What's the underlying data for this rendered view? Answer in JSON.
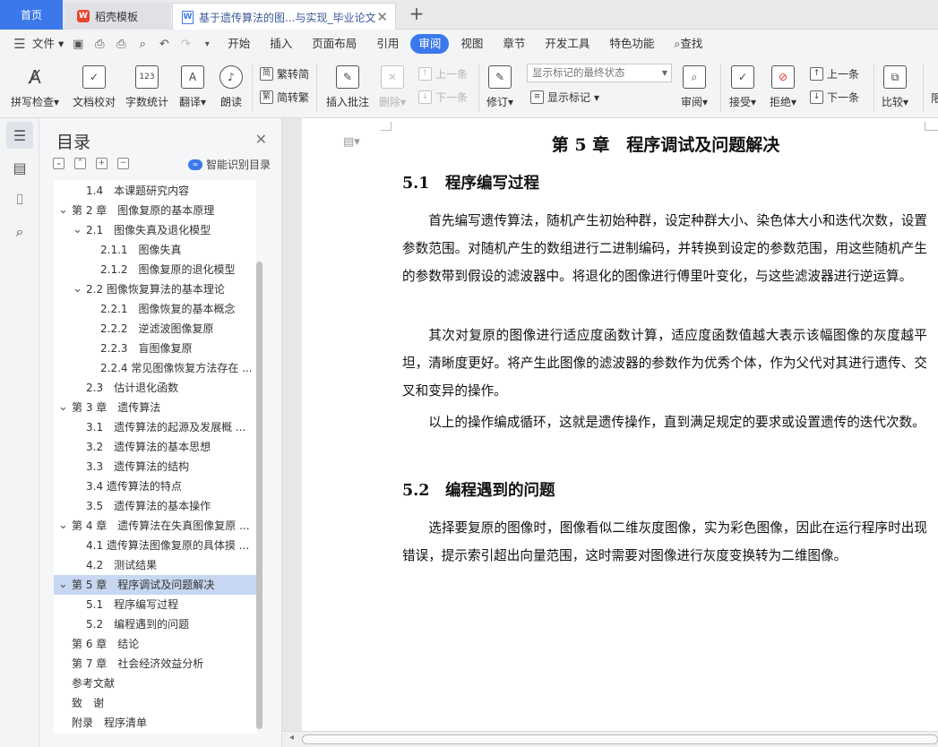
{
  "tabs": {
    "home": "首页",
    "template": "稻壳模板",
    "document": "基于遗传算法的图...与实现_毕业论文"
  },
  "menu": [
    "文件",
    "开始",
    "插入",
    "页面布局",
    "引用",
    "审阅",
    "视图",
    "章节",
    "开发工具",
    "特色功能",
    "查找"
  ],
  "ribbon": {
    "spell_check": "拼写检查",
    "doc_proof": "文档校对",
    "word_count": "字数统计",
    "translate": "翻译",
    "read_aloud": "朗读",
    "to_simplified": "繁转简",
    "to_traditional": "简转繁",
    "insert_comment": "插入批注",
    "delete": "删除",
    "prev_comment": "上一条",
    "next_comment": "下一条",
    "track_changes": "修订",
    "markup_state": "显示标记的最终状态",
    "show_markup": "显示标记",
    "review": "审阅",
    "accept": "接受",
    "reject": "拒绝",
    "prev_change": "上一条",
    "next_change": "下一条",
    "compare": "比较",
    "restrict": "限"
  },
  "toc": {
    "title": "目录",
    "smart_label": "智能识别目录",
    "items": [
      {
        "text": "1.4　本课题研究内容",
        "level": 2,
        "chevron": false,
        "active": false
      },
      {
        "text": "第 2 章　图像复原的基本原理",
        "level": 1,
        "chevron": true,
        "active": false
      },
      {
        "text": "2.1　图像失真及退化模型",
        "level": 2,
        "chevron": true,
        "active": false
      },
      {
        "text": "2.1.1　图像失真",
        "level": 3,
        "chevron": false,
        "active": false
      },
      {
        "text": "2.1.2　图像复原的退化模型",
        "level": 3,
        "chevron": false,
        "active": false
      },
      {
        "text": "2.2 图像恢复算法的基本理论",
        "level": 2,
        "chevron": true,
        "active": false
      },
      {
        "text": "2.2.1　图像恢复的基本概念",
        "level": 3,
        "chevron": false,
        "active": false
      },
      {
        "text": "2.2.2　逆滤波图像复原",
        "level": 3,
        "chevron": false,
        "active": false
      },
      {
        "text": "2.2.3　盲图像复原",
        "level": 3,
        "chevron": false,
        "active": false
      },
      {
        "text": "2.2.4 常见图像恢复方法存在 ...",
        "level": 3,
        "chevron": false,
        "active": false
      },
      {
        "text": "2.3　估计退化函数",
        "level": 2,
        "chevron": false,
        "active": false
      },
      {
        "text": "第 3 章　遗传算法",
        "level": 1,
        "chevron": true,
        "active": false
      },
      {
        "text": "3.1　遗传算法的起源及发展概 ...",
        "level": 2,
        "chevron": false,
        "active": false
      },
      {
        "text": "3.2　遗传算法的基本思想",
        "level": 2,
        "chevron": false,
        "active": false
      },
      {
        "text": "3.3　遗传算法的结构",
        "level": 2,
        "chevron": false,
        "active": false
      },
      {
        "text": "3.4 遗传算法的特点",
        "level": 2,
        "chevron": false,
        "active": false
      },
      {
        "text": "3.5　遗传算法的基本操作",
        "level": 2,
        "chevron": false,
        "active": false
      },
      {
        "text": "第 4 章　遗传算法在失真图像复原 ...",
        "level": 1,
        "chevron": true,
        "active": false
      },
      {
        "text": "4.1 遗传算法图像复原的具体摸 ...",
        "level": 2,
        "chevron": false,
        "active": false
      },
      {
        "text": "4.2　测试结果",
        "level": 2,
        "chevron": false,
        "active": false
      },
      {
        "text": "第 5 章　程序调试及问题解决",
        "level": 1,
        "chevron": true,
        "active": true
      },
      {
        "text": "5.1　程序编写过程",
        "level": 2,
        "chevron": false,
        "active": false
      },
      {
        "text": "5.2　编程遇到的问题",
        "level": 2,
        "chevron": false,
        "active": false
      },
      {
        "text": "第 6 章　结论",
        "level": 1,
        "chevron": false,
        "active": false
      },
      {
        "text": "第 7 章　社会经济效益分析",
        "level": 1,
        "chevron": false,
        "active": false
      },
      {
        "text": "参考文献",
        "level": 1,
        "chevron": false,
        "active": false
      },
      {
        "text": "致　谢",
        "level": 1,
        "chevron": false,
        "active": false
      },
      {
        "text": "附录　程序清单",
        "level": 1,
        "chevron": false,
        "active": false
      }
    ]
  },
  "document": {
    "chapter_title": "第 5 章　程序调试及问题解决",
    "sections": [
      {
        "heading": "5.1　程序编写过程",
        "paragraphs": [
          "首先编写遗传算法，随机产生初始种群，设定种群大小、染色体大小和迭代次数，设置参数范围。对随机产生的数组进行二进制编码，并转换到设定的参数范围，用这些随机产生的参数带到假设的滤波器中。将退化的图像进行傅里叶变化，与这些滤波器进行逆运算。",
          "其次对复原的图像进行适应度函数计算，适应度函数值越大表示该幅图像的灰度越平坦，清晰度更好。将产生此图像的滤波器的参数作为优秀个体，作为父代对其进行遗传、交叉和变异的操作。",
          "以上的操作编成循环，这就是遗传操作，直到满足规定的要求或设置遗传的迭代次数。"
        ]
      },
      {
        "heading": "5.2　编程遇到的问题",
        "paragraphs": [
          "选择要复原的图像时，图像看似二维灰度图像，实为彩色图像，因此在运行程序时出现错误，提示索引超出向量范围，这时需要对图像进行灰度变换转为二维图像。"
        ]
      }
    ]
  }
}
